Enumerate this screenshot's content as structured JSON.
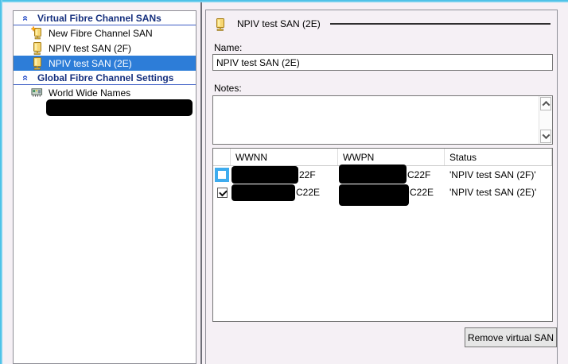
{
  "colors": {
    "window_border": "#54C6EA",
    "dialog_background": "#F5F0F5",
    "tree_selection": "#2D7DD8",
    "section_title": "#16307E",
    "section_underline": "#3D5EC6",
    "redaction": "#000000"
  },
  "sidebar": {
    "sections": [
      {
        "title": "Virtual Fibre Channel SANs",
        "items": [
          {
            "label": "New Fibre Channel SAN",
            "icon": "san-new-icon",
            "selected": false
          },
          {
            "label": "NPIV test SAN (2F)",
            "icon": "san-icon",
            "selected": false
          },
          {
            "label": "NPIV test SAN (2E)",
            "icon": "san-icon",
            "selected": true
          }
        ]
      },
      {
        "title": "Global Fibre Channel Settings",
        "items": [
          {
            "label": "World Wide Names",
            "icon": "network-adapter-icon",
            "selected": false
          }
        ]
      }
    ],
    "redacted_region": true
  },
  "detail": {
    "title": "NPIV test SAN (2E)",
    "name_label": "Name:",
    "name_value": "NPIV test SAN (2E)",
    "notes_label": "Notes:",
    "notes_value": "",
    "table": {
      "columns": {
        "checkbox": "",
        "wwnn": "WWNN",
        "wwpn": "WWPN",
        "status": "Status"
      },
      "rows": [
        {
          "checked": false,
          "focused": true,
          "wwnn_redacted": true,
          "wwnn_visible": "22F",
          "wwpn_redacted": true,
          "wwpn_visible": "C22F",
          "status": "'NPIV test SAN (2F)'"
        },
        {
          "checked": true,
          "focused": false,
          "wwnn_redacted": true,
          "wwnn_visible": "C22E",
          "wwpn_redacted": true,
          "wwpn_visible": "C22E",
          "status": "'NPIV test SAN (2E)'"
        }
      ]
    },
    "remove_button_label": "Remove virtual SAN"
  }
}
